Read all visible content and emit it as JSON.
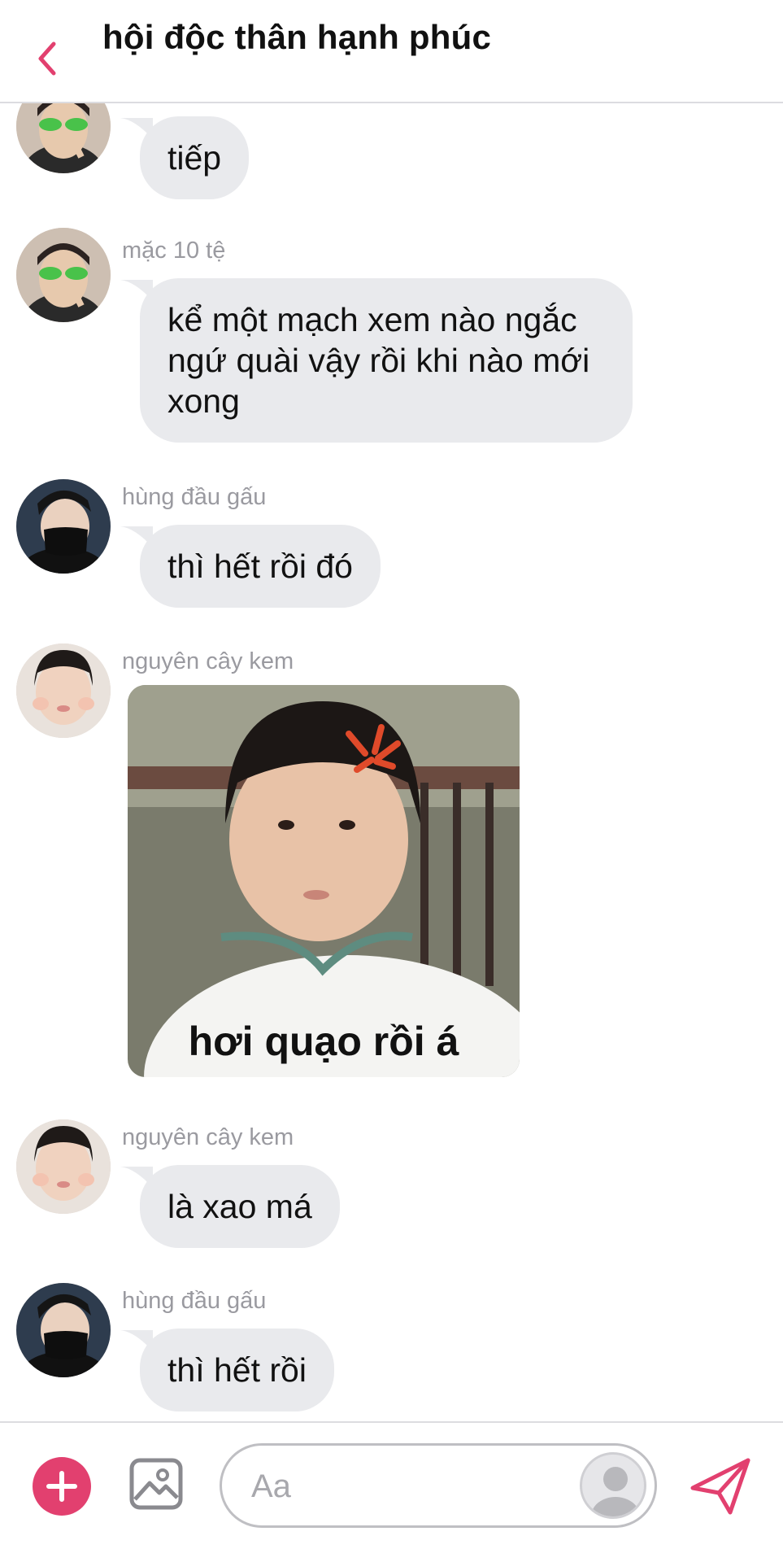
{
  "header": {
    "title": "hội độc thân hạnh phúc",
    "back_icon": "chevron-left-icon"
  },
  "messages": [
    {
      "sender": "",
      "text": "tiếp",
      "avatar": "green-alien-glasses-avatar"
    },
    {
      "sender": "mặc 10 tệ",
      "lines": [
        "kể một mạch xem nào ngắc",
        "ngứ quài vậy rồi khi nào mới",
        "xong"
      ],
      "avatar": "green-alien-glasses-avatar"
    },
    {
      "sender": "hùng đầu gấu",
      "text": "thì hết rồi đó",
      "avatar": "masked-boy-avatar"
    },
    {
      "sender": "nguyên cây kem",
      "image_caption": "hơi quạo rồi á",
      "avatar": "cheek-squish-avatar"
    },
    {
      "sender": "nguyên cây kem",
      "text": "là xao má",
      "avatar": "cheek-squish-avatar"
    },
    {
      "sender": "hùng đầu gấu",
      "text": "thì hết rồi",
      "avatar": "masked-boy-avatar"
    }
  ],
  "composer": {
    "placeholder": "Aa",
    "plus_icon": "plus-icon",
    "gallery_icon": "image-icon",
    "send_icon": "send-icon"
  },
  "colors": {
    "accent": "#e2406f",
    "bubble": "#e9eaed",
    "sender_text": "#9a9aa0"
  }
}
